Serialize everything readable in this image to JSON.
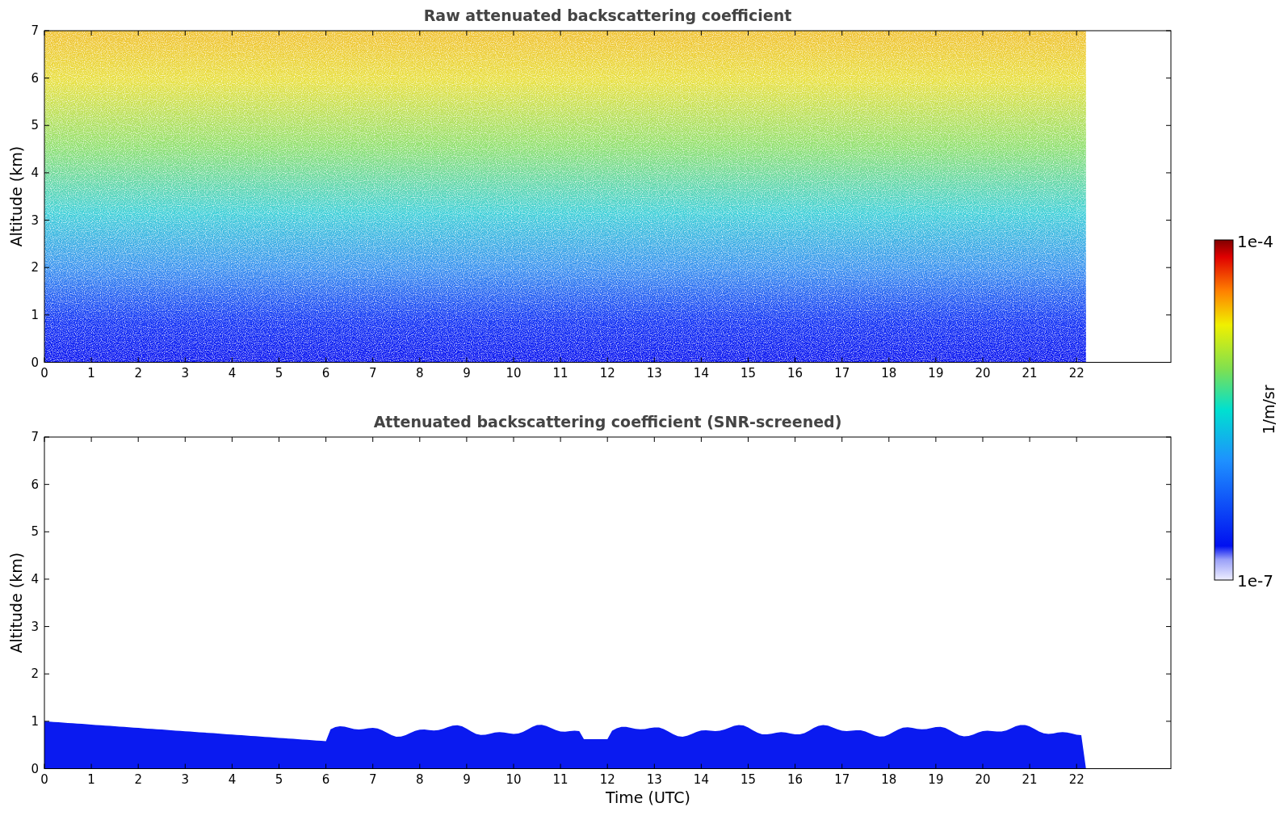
{
  "panels": [
    {
      "title": "Raw attenuated backscattering coefficient",
      "ylabel": "Altitude (km)",
      "yticks": [
        "7",
        "6",
        "5",
        "4",
        "3",
        "2",
        "1",
        "0"
      ],
      "xticks": [
        "0",
        "1",
        "2",
        "3",
        "4",
        "5",
        "6",
        "7",
        "8",
        "9",
        "10",
        "11",
        "12",
        "13",
        "14",
        "15",
        "16",
        "17",
        "18",
        "19",
        "20",
        "21",
        "22"
      ],
      "kind": "raw"
    },
    {
      "title": "Attenuated backscattering coefficient (SNR-screened)",
      "ylabel": "Altitude (km)",
      "yticks": [
        "7",
        "6",
        "5",
        "4",
        "3",
        "2",
        "1",
        "0"
      ],
      "xticks": [
        "0",
        "1",
        "2",
        "3",
        "4",
        "5",
        "6",
        "7",
        "8",
        "9",
        "10",
        "11",
        "12",
        "13",
        "14",
        "15",
        "16",
        "17",
        "18",
        "19",
        "20",
        "21",
        "22"
      ],
      "xlabel": "Time (UTC)",
      "kind": "screened"
    }
  ],
  "colorbar": {
    "max_label": "1e-4",
    "min_label": "1e-7",
    "label": "1/m/sr"
  }
}
